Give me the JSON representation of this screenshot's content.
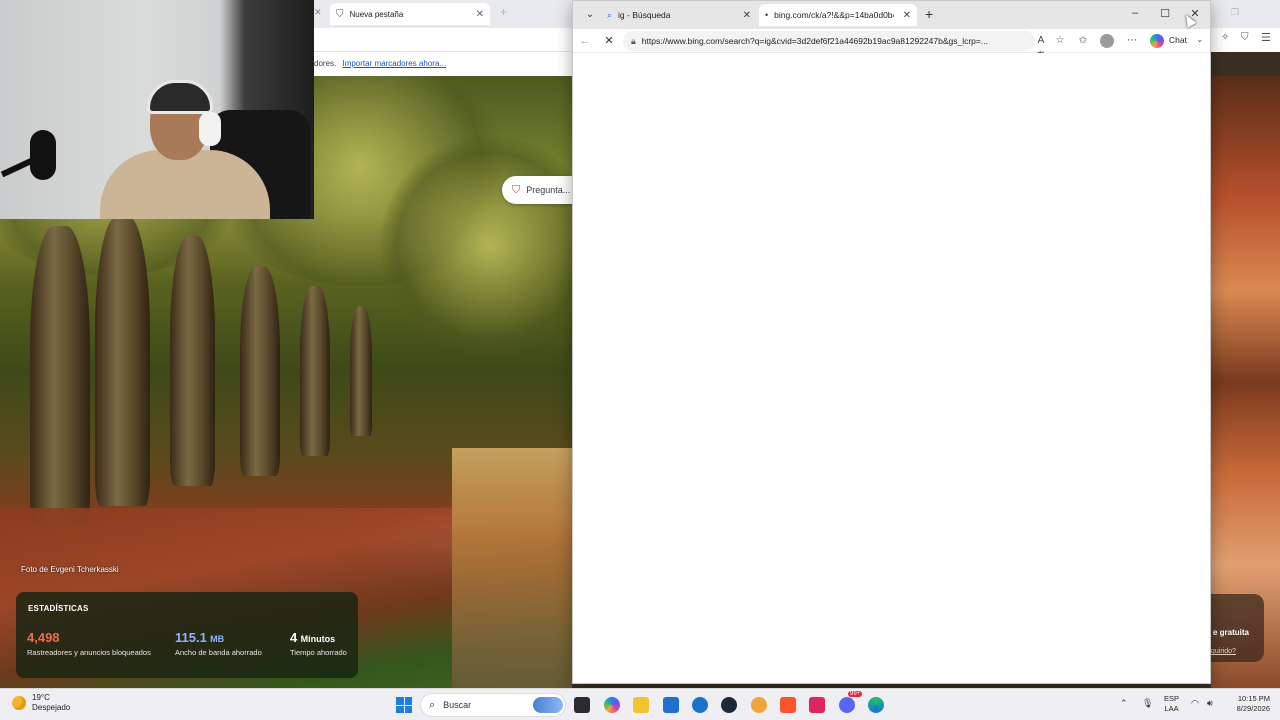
{
  "background_browser": {
    "tab_title": "Nueva pestaña",
    "bookmarks_prefix": "dores.",
    "bookmarks_link": "Importar marcadores ahora...",
    "brave_search_pill": "Pregunta..."
  },
  "wallpaper": {
    "photo_credit": "Foto de Evgeni Tcherkasski",
    "right_button": "e gratuita",
    "right_link": "quirido?"
  },
  "stats": {
    "title": "ESTADÍSTICAS",
    "trackers_value": "4,498",
    "trackers_label": "Rastreadores y anuncios bloqueados",
    "bandwidth_value": "115.1",
    "bandwidth_unit": "MB",
    "bandwidth_label": "Ancho de banda ahorrado",
    "time_value": "4",
    "time_unit": "Minutos",
    "time_label": "Tiempo ahorrado",
    "colors": {
      "trackers": "#f36a4c",
      "bandwidth": "#8fb4ff",
      "time": "#ffffff"
    }
  },
  "edge": {
    "tabs": [
      {
        "title": "ig - Búsqueda",
        "icon": "search-icon",
        "active": false
      },
      {
        "title": "bing.com/ck/a?!&&p=14ba0d0b4",
        "icon": "loading-dot-icon",
        "active": true
      }
    ],
    "address_url": "https://www.bing.com/search?q=ig&cvid=3d2def6f21a44692b19ac9a81292247b&gs_lcrp=...",
    "chat_label": "Chat",
    "loading": true
  },
  "taskbar": {
    "weather_temp": "19°C",
    "weather_desc": "Despejado",
    "search_placeholder": "Buscar",
    "lang_line1": "ESP",
    "lang_line2": "LAA",
    "time": "10:15 PM",
    "date": "8/29/2026",
    "discord_badge": "99+"
  }
}
